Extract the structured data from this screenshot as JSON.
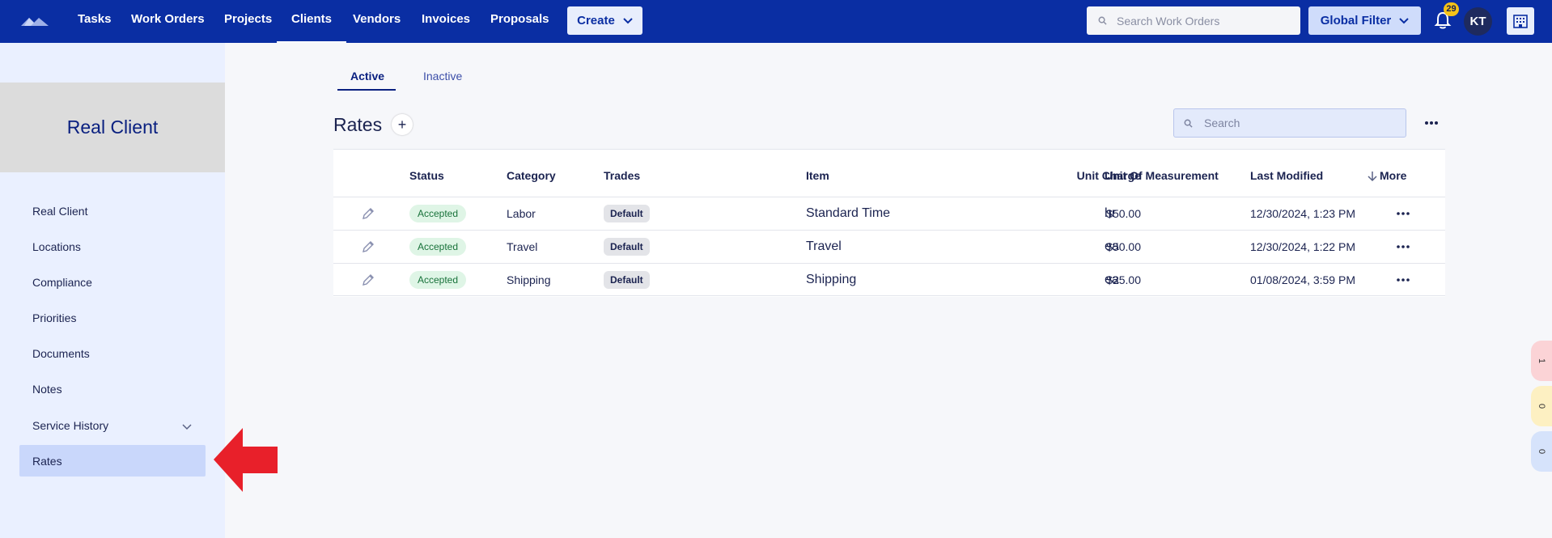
{
  "nav": {
    "items": [
      "Tasks",
      "Work Orders",
      "Projects",
      "Clients",
      "Vendors",
      "Invoices",
      "Proposals"
    ],
    "active": "Clients",
    "create_label": "Create",
    "search_placeholder": "Search Work Orders",
    "global_filter_label": "Global Filter",
    "notification_count": "29",
    "avatar_initials": "KT"
  },
  "sidebar": {
    "client_name": "Real Client",
    "items": [
      "Real Client",
      "Locations",
      "Compliance",
      "Priorities",
      "Documents",
      "Notes",
      "Service History",
      "Rates"
    ],
    "active": "Rates"
  },
  "tabs": {
    "active": "Active",
    "inactive": "Inactive"
  },
  "main": {
    "title": "Rates",
    "add_symbol": "+",
    "search_placeholder": "Search"
  },
  "table": {
    "headers": [
      "Status",
      "Category",
      "Trades",
      "Item",
      "Unit Charge",
      "Unit Of Measurement",
      "Last Modified",
      "More"
    ],
    "rows": [
      {
        "status": "Accepted",
        "category": "Labor",
        "trade": "Default",
        "item": "Standard Time",
        "unit_charge": "$50.00",
        "uom": "hr",
        "last_modified": "12/30/2024, 1:23 PM"
      },
      {
        "status": "Accepted",
        "category": "Travel",
        "trade": "Default",
        "item": "Travel",
        "unit_charge": "$50.00",
        "uom": "ea",
        "last_modified": "12/30/2024, 1:22 PM"
      },
      {
        "status": "Accepted",
        "category": "Shipping",
        "trade": "Default",
        "item": "Shipping",
        "unit_charge": "$25.00",
        "uom": "ea",
        "last_modified": "01/08/2024, 3:59 PM"
      }
    ]
  },
  "side_pills": [
    {
      "value": "1",
      "color": "#fbd3d6"
    },
    {
      "value": "0",
      "color": "#fdf0c2"
    },
    {
      "value": "0",
      "color": "#d6e3fb"
    }
  ],
  "colors": {
    "primary": "#0a2ea3",
    "sidebar_bg": "#eaf0ff",
    "active_item": "#c9d7fb",
    "accepted": "#dff5e6",
    "annotation_arrow": "#e8202a"
  }
}
